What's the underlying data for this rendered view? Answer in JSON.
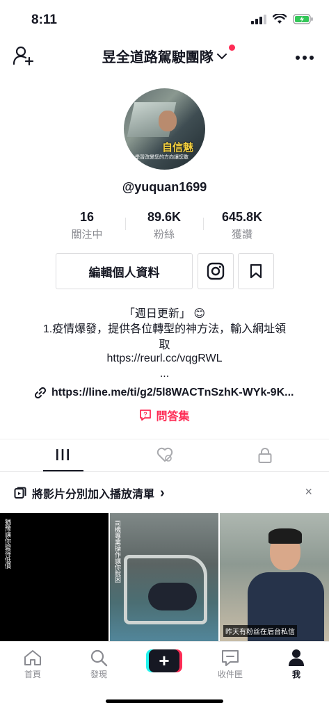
{
  "status": {
    "time": "8:11"
  },
  "header": {
    "title": "昱全道路駕駛團隊"
  },
  "profile": {
    "avatar_caption_yellow": "自信魅",
    "avatar_caption_white": "學習改變您的方向讓您敢",
    "username": "@yuquan1699"
  },
  "stats": [
    {
      "value": "16",
      "label": "關注中"
    },
    {
      "value": "89.6K",
      "label": "粉絲"
    },
    {
      "value": "645.8K",
      "label": "獲讚"
    }
  ],
  "buttons": {
    "edit_profile": "編輯個人資料"
  },
  "bio": {
    "line1": "「週日更新」 😊",
    "line2": "1.疫情爆發，提供各位轉型的神方法，輸入網址領",
    "line3": "取",
    "line4": "https://reurl.cc/vqgRWL",
    "line5": "...",
    "link": "https://line.me/ti/g2/5l8WACTnSzhK-WYk-9K...",
    "qa_label": "問答集"
  },
  "playlist": {
    "label": "將影片分別加入播放清單",
    "chevron": "›",
    "close": "×"
  },
  "videos": [
    {
      "overlay": "猶豫讓你變得低價"
    },
    {
      "overlay": "司機專業操作讓你脫困"
    },
    {
      "caption": "昨天有粉丝在后台私信"
    }
  ],
  "nav": {
    "items": [
      {
        "label": "首頁"
      },
      {
        "label": "發現"
      },
      {
        "label": "收件匣"
      },
      {
        "label": "我"
      }
    ],
    "plus": "+"
  },
  "colors": {
    "accent": "#fe2c55",
    "cyan": "#25f4ee",
    "text": "#161823",
    "muted": "#8a8b91"
  }
}
